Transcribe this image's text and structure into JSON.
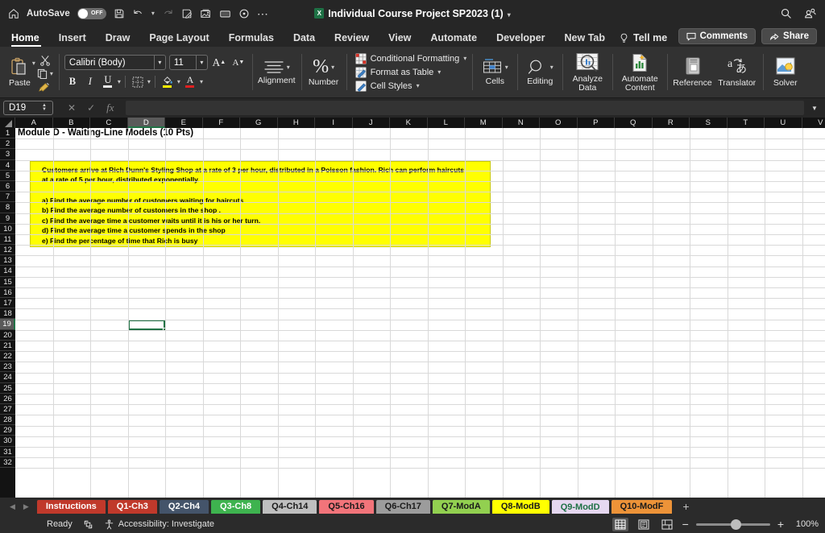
{
  "titlebar": {
    "home_icon": "home-icon",
    "autosave_label": "AutoSave",
    "autosave_state": "OFF",
    "save_icon": "save-icon",
    "undo_icon": "undo-icon",
    "redo_icon": "redo-icon",
    "save_as_icon": "save-as-icon",
    "picture_icon": "picture-icon",
    "window_icon": "window-icon",
    "record_icon": "record-icon",
    "more_icon": "more-options-icon",
    "document_title": "Individual Course Project SP2023 (1)",
    "title_caret": "chevron-down-icon",
    "search_icon": "search-icon",
    "account_icon": "account-people-icon"
  },
  "ribbon_tabs": {
    "tabs": [
      {
        "label": "Home",
        "active": true
      },
      {
        "label": "Insert",
        "active": false
      },
      {
        "label": "Draw",
        "active": false
      },
      {
        "label": "Page Layout",
        "active": false
      },
      {
        "label": "Formulas",
        "active": false
      },
      {
        "label": "Data",
        "active": false
      },
      {
        "label": "Review",
        "active": false
      },
      {
        "label": "View",
        "active": false
      },
      {
        "label": "Automate",
        "active": false
      },
      {
        "label": "Developer",
        "active": false
      },
      {
        "label": "New Tab",
        "active": false
      }
    ],
    "tell_me": "Tell me",
    "tell_me_icon": "lightbulb-icon",
    "comments_label": "Comments",
    "comments_icon": "comment-icon",
    "share_label": "Share",
    "share_icon": "share-icon"
  },
  "ribbon": {
    "clipboard": {
      "paste_label": "Paste",
      "paste_icon": "paste-icon",
      "cut_icon": "scissors-icon",
      "copy_icon": "copy-icon",
      "format_painter_icon": "format-painter-icon"
    },
    "font": {
      "font_name": "Calibri (Body)",
      "font_size": "11",
      "grow_font_icon": "grow-font-icon",
      "shrink_font_icon": "shrink-font-icon",
      "bold": "B",
      "italic": "I",
      "underline": "U",
      "borders_icon": "borders-icon",
      "fill_color_icon": "fill-color-icon",
      "font_color_icon": "font-color-icon",
      "fill_color": "#FFF200",
      "font_color": "#E02020"
    },
    "alignment": {
      "label": "Alignment",
      "icon": "alignment-icon"
    },
    "number": {
      "label": "Number",
      "icon": "percent-icon"
    },
    "styles": [
      {
        "label": "Conditional Formatting",
        "icon": "conditional-formatting-icon"
      },
      {
        "label": "Format as Table",
        "icon": "format-as-table-icon"
      },
      {
        "label": "Cell Styles",
        "icon": "cell-styles-icon"
      }
    ],
    "cells": {
      "label": "Cells",
      "icon": "cells-icon"
    },
    "editing": {
      "label": "Editing",
      "icon": "editing-magnifier-icon"
    },
    "analyze_data": {
      "label": "Analyze\nData",
      "icon": "analyze-data-icon"
    },
    "automate_content": {
      "label": "Automate\nContent",
      "icon": "automate-content-icon"
    },
    "reference": {
      "label": "Reference",
      "icon": "reference-book-icon"
    },
    "translator": {
      "label": "Translator",
      "icon": "translator-icon"
    },
    "solver": {
      "label": "Solver",
      "icon": "solver-icon"
    }
  },
  "formula_bar": {
    "name_box": "D19",
    "cancel_icon": "cancel-x-icon",
    "confirm_icon": "confirm-check-icon",
    "function_icon": "fx-icon",
    "formula_value": "",
    "expand_icon": "expand-formula-bar-icon"
  },
  "grid": {
    "columns": [
      "A",
      "B",
      "C",
      "D",
      "E",
      "F",
      "G",
      "H",
      "I",
      "J",
      "K",
      "L",
      "M",
      "N",
      "O",
      "P",
      "Q",
      "R",
      "S",
      "T",
      "U",
      "V"
    ],
    "selected_column": "D",
    "rows": [
      1,
      2,
      3,
      4,
      5,
      6,
      7,
      8,
      9,
      10,
      11,
      12,
      13,
      14,
      15,
      16,
      17,
      18,
      19,
      20,
      21,
      22,
      23,
      24,
      25,
      26,
      27,
      28,
      29,
      30,
      31,
      32
    ],
    "selected_row": 19,
    "selected_cell": "D19",
    "title_cell": {
      "ref": "A1",
      "text": "Module D - Waiting-Line Models (10 Pts)"
    },
    "note_block": {
      "highlight_color": "#FFFF00",
      "lines": [
        "Customers arrive at Rich Dunn's Styling Shop at a rate of 3 per hour, distributed in a Poisson fashion. Rich can perform haircuts",
        "at a rate of 5 per hour, distributed exponentially.",
        "",
        "a) Find the average number of customers waiting for haircuts",
        "b) Find the average number of customers in the shop .",
        "c) Find the average time a customer waits until it is his or her turn.",
        "d) Find the average time a customer spends in the shop",
        "e) Find the percentage of time that Rich is busy"
      ]
    }
  },
  "sheet_tabs": {
    "prev_icon": "previous-sheet-icon",
    "next_icon": "next-sheet-icon",
    "add_label": "+",
    "tabs": [
      {
        "label": "Instructions",
        "bg": "#C0392B",
        "fg": "#ffffff",
        "active": false
      },
      {
        "label": "Q1-Ch3",
        "bg": "#C0392B",
        "fg": "#ffffff",
        "active": false
      },
      {
        "label": "Q2-Ch4",
        "bg": "#44546A",
        "fg": "#ffffff",
        "active": false
      },
      {
        "label": "Q3-Ch8",
        "bg": "#3EB34F",
        "fg": "#ffffff",
        "active": false
      },
      {
        "label": "Q4-Ch14",
        "bg": "#BFBFBF",
        "fg": "#1a1a1a",
        "active": false
      },
      {
        "label": "Q5-Ch16",
        "bg": "#F2747A",
        "fg": "#1a1a1a",
        "active": false
      },
      {
        "label": "Q6-Ch17",
        "bg": "#9C9C9C",
        "fg": "#1a1a1a",
        "active": false
      },
      {
        "label": "Q7-ModA",
        "bg": "#92D050",
        "fg": "#1a1a1a",
        "active": false
      },
      {
        "label": "Q8-ModB",
        "bg": "#FFFF00",
        "fg": "#1a1a1a",
        "active": false
      },
      {
        "label": "Q9-ModD",
        "bg": "#E6D8F0",
        "fg": "#1e7145",
        "active": true
      },
      {
        "label": "Q10-ModF",
        "bg": "#ED9338",
        "fg": "#1a1a1a",
        "active": false
      }
    ]
  },
  "status_bar": {
    "status": "Ready",
    "selection_icon": "selection-mode-icon",
    "accessibility_icon": "accessibility-icon",
    "accessibility_label": "Accessibility: Investigate",
    "view_normal_icon": "normal-view-icon",
    "view_layout_icon": "page-layout-view-icon",
    "view_pagebreak_icon": "page-break-view-icon",
    "zoom_out": "−",
    "zoom_in": "+",
    "zoom_level": "100%"
  }
}
